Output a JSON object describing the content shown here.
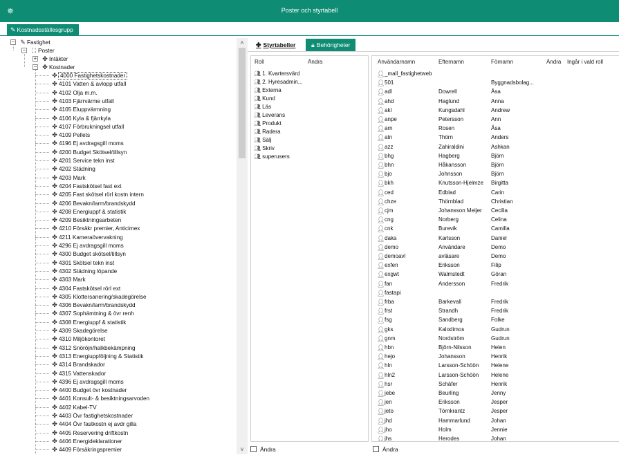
{
  "window": {
    "title": "Poster och styrtabell",
    "app_icon": "gear-icon"
  },
  "top_tabs": [
    {
      "label": "Kostnadsställesgrupp",
      "icon": "pencil-icon"
    }
  ],
  "tree": {
    "root": "Fastighet",
    "poster": "Poster",
    "intakter": "Intäkter",
    "kostnader": "Kostnader",
    "items": [
      "4000 Fastighetskostnader",
      "4101 Vatten & avlopp utfall",
      "4102 Olja m.m.",
      "4103 Fjärrvärme utfall",
      "4105 Eluppvärmning",
      "4106 Kyla & fjärrkyla",
      "4107 Förbrukningsel utfall",
      "4109 Pellets",
      "4196 Ej avdragsgill moms",
      "4200 Budget Skötsel/tillsyn",
      "4201 Service tekn inst",
      "4202 Städning",
      "4203 Mark",
      "4204 Fastskötsel fast ext",
      "4205 Fast skötsel rörl kostn intern",
      "4206 Bevakn/larm/brandskydd",
      "4208 Energiuppf & statistik",
      "4209 Besiktningsarbeten",
      "4210 Försäkr premier, Anticimex",
      "4211 Kameraövervakning",
      "4296 Ej avdragsgill moms",
      "4300 Budget skötsel/tillsyn",
      "4301 Skötsel tekn inst",
      "4302 Städning löpande",
      "4303 Mark",
      "4304 Fastskötsel rörl ext",
      "4305 Klottersanering/skadegörelse",
      "4306 Bevakn/larm/brandskydd",
      "4307 Sophämtning & övr renh",
      "4308 Energiuppf & statistik",
      "4309 Skadegörelse",
      "4310 Miljökontoret",
      "4312 Snöröjn/halkbekämpning",
      "4313 Energiuppföljning & Statistik",
      "4314 Brandskador",
      "4315 Vattenskador",
      "4396 Ej avdragsgill moms",
      "4400 Budget övr kostnader",
      "4401 Konsult- & besiktningsarvoden",
      "4402 Kabel-TV",
      "4403 Övr fastighetskostnader",
      "4404 Övr fastkostn ej avdr gilla",
      "4405 Reservering driftkostn",
      "4406 Energideklarationer",
      "4409 Försäkringspremier"
    ]
  },
  "right_tabs": [
    {
      "label": "Styrtabeller",
      "icon": "grid-icon"
    },
    {
      "label": "Behörigheter",
      "icon": "lock-icon"
    }
  ],
  "roles": {
    "headers": {
      "roll": "Roll",
      "andra": "Ändra"
    },
    "items": [
      "1. Kvartersvärd",
      "2. Hyresadmin...",
      "Externa",
      "Kund",
      "Läs",
      "Leverans",
      "Produkt",
      "Radera",
      "Sälj",
      "Skriv",
      "superusers"
    ]
  },
  "users": {
    "headers": {
      "anvandarnamn": "Användarnamn",
      "efternamn": "Efternamn",
      "fornamn": "Förnamn",
      "andra": "Ändra",
      "ingar": "Ingår i vald roll"
    },
    "rows": [
      [
        "_mall_fastighetweb",
        "",
        ""
      ],
      [
        "501",
        "",
        "Byggnadsbolag..."
      ],
      [
        "adl",
        "Dowrell",
        "Åsa"
      ],
      [
        "ahd",
        "Haglund",
        "Anna"
      ],
      [
        "akl",
        "Kungsdahl",
        "Andrew"
      ],
      [
        "anpe",
        "Petersson",
        "Ann"
      ],
      [
        "arn",
        "Rosen",
        "Åsa"
      ],
      [
        "atn",
        "Thörn",
        "Anders"
      ],
      [
        "azz",
        "Zahiraldini",
        "Ashkan"
      ],
      [
        "bhg",
        "Hagberg",
        "Björn"
      ],
      [
        "bhn",
        "Håkansson",
        "Björn"
      ],
      [
        "bjo",
        "Johnsson",
        "Björn"
      ],
      [
        "bkh",
        "Knutsson-Hjelmze",
        "Birgitta"
      ],
      [
        "ced",
        "Edblad",
        "Carin"
      ],
      [
        "chze",
        "Thörnblad",
        "Christian"
      ],
      [
        "cjm",
        "Johansson Meijer",
        "Cecilia"
      ],
      [
        "cng",
        "Norberg",
        "Celina"
      ],
      [
        "cnk",
        "Burevik",
        "Camilla"
      ],
      [
        "daka",
        "Karlsson",
        "Daniel"
      ],
      [
        "demo",
        "Användare",
        "Demo"
      ],
      [
        "demoavl",
        "avläsare",
        "Demo"
      ],
      [
        "exfen",
        "Eriksson",
        "Filip"
      ],
      [
        "exgwt",
        "Walmstedt",
        "Göran"
      ],
      [
        "fan",
        "Andersson",
        "Fredrik"
      ],
      [
        "fastapi",
        "",
        ""
      ],
      [
        "frba",
        "Barkevall",
        "Fredrik"
      ],
      [
        "frst",
        "Strandh",
        "Fredrik"
      ],
      [
        "fsg",
        "Sandberg",
        "Folke"
      ],
      [
        "gks",
        "Kalodimos",
        "Gudrun"
      ],
      [
        "gnm",
        "Nordström",
        "Gudrun"
      ],
      [
        "hbn",
        "Björn-Nilsson",
        "Helen"
      ],
      [
        "hejo",
        "Johansson",
        "Henrik"
      ],
      [
        "hln",
        "Larsson-Schöön",
        "Helene"
      ],
      [
        "hln2",
        "Larsson-Schöön",
        "Helene"
      ],
      [
        "hsr",
        "Schäfer",
        "Henrik"
      ],
      [
        "jebe",
        "Beurling",
        "Jenny"
      ],
      [
        "jen",
        "Eriksson",
        "Jesper"
      ],
      [
        "jeto",
        "Törnkrantz",
        "Jesper"
      ],
      [
        "jhd",
        "Hammarlund",
        "Johan"
      ],
      [
        "jho",
        "Holm",
        "Jennie"
      ],
      [
        "jhs",
        "Herodes",
        "Johan"
      ]
    ]
  },
  "footer": {
    "roles_andra": "Ändra",
    "users_andra": "Ändra"
  },
  "colors": {
    "accent": "#0e8c74"
  }
}
